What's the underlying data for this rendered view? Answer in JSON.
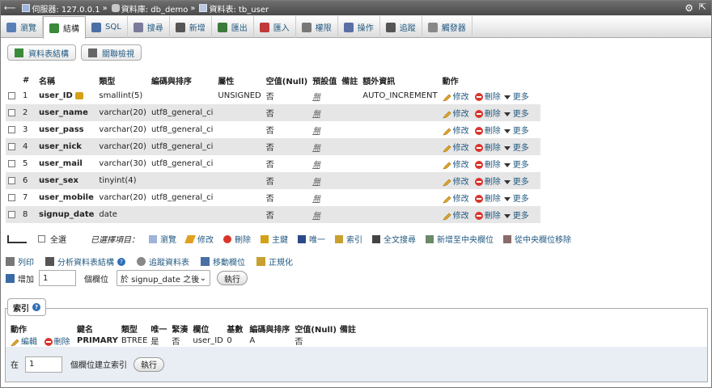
{
  "breadcrumb": {
    "collapse_icon": "arrow-left",
    "server": "伺服器: 127.0.0.1",
    "sep1": "»",
    "database": "資料庫: db_demo",
    "sep2": "»",
    "table": "資料表: tb_user"
  },
  "tabs": [
    {
      "label": "瀏覽",
      "icon": "table-icon",
      "color": "#5a7fb5"
    },
    {
      "label": "結構",
      "icon": "structure-icon",
      "color": "#3a8a3a"
    },
    {
      "label": "SQL",
      "icon": "sql-icon",
      "color": "#4a6fa5"
    },
    {
      "label": "搜尋",
      "icon": "search-icon",
      "color": "#7a7a9a"
    },
    {
      "label": "新增",
      "icon": "insert-icon",
      "color": "#555"
    },
    {
      "label": "匯出",
      "icon": "export-icon",
      "color": "#3a7a3a"
    },
    {
      "label": "匯入",
      "icon": "import-icon",
      "color": "#c03a3a"
    },
    {
      "label": "權限",
      "icon": "privileges-icon",
      "color": "#777"
    },
    {
      "label": "操作",
      "icon": "wrench-icon",
      "color": "#5a6fa5"
    },
    {
      "label": "追蹤",
      "icon": "eye-icon",
      "color": "#555"
    },
    {
      "label": "觸發器",
      "icon": "triggers-icon",
      "color": "#888"
    }
  ],
  "subtabs": {
    "structure": "資料表結構",
    "relation": "關聯檢視"
  },
  "headers": {
    "num": "#",
    "name": "名稱",
    "type": "類型",
    "collation": "編碼與排序",
    "attributes": "屬性",
    "null": "空值(Null)",
    "default": "預設值",
    "comments": "備註",
    "extra": "額外資訊",
    "action": "動作"
  },
  "columns": [
    {
      "num": "1",
      "name": "user_ID",
      "key": true,
      "type": "smallint(5)",
      "collation": "",
      "attributes": "UNSIGNED",
      "null": "否",
      "default": "無",
      "extra": "AUTO_INCREMENT"
    },
    {
      "num": "2",
      "name": "user_name",
      "key": false,
      "type": "varchar(20)",
      "collation": "utf8_general_ci",
      "attributes": "",
      "null": "否",
      "default": "無",
      "extra": ""
    },
    {
      "num": "3",
      "name": "user_pass",
      "key": false,
      "type": "varchar(20)",
      "collation": "utf8_general_ci",
      "attributes": "",
      "null": "否",
      "default": "無",
      "extra": ""
    },
    {
      "num": "4",
      "name": "user_nick",
      "key": false,
      "type": "varchar(20)",
      "collation": "utf8_general_ci",
      "attributes": "",
      "null": "否",
      "default": "無",
      "extra": ""
    },
    {
      "num": "5",
      "name": "user_mail",
      "key": false,
      "type": "varchar(30)",
      "collation": "utf8_general_ci",
      "attributes": "",
      "null": "否",
      "default": "無",
      "extra": ""
    },
    {
      "num": "6",
      "name": "user_sex",
      "key": false,
      "type": "tinyint(4)",
      "collation": "",
      "attributes": "",
      "null": "否",
      "default": "無",
      "extra": ""
    },
    {
      "num": "7",
      "name": "user_mobile",
      "key": false,
      "type": "varchar(20)",
      "collation": "utf8_general_ci",
      "attributes": "",
      "null": "否",
      "default": "無",
      "extra": ""
    },
    {
      "num": "8",
      "name": "signup_date",
      "key": false,
      "type": "date",
      "collation": "",
      "attributes": "",
      "null": "否",
      "default": "無",
      "extra": ""
    }
  ],
  "row_actions": {
    "change": "修改",
    "drop": "刪除",
    "more": "更多"
  },
  "bulk": {
    "check_all": "全選",
    "with_selected": "已選擇項目：",
    "browse": "瀏覽",
    "change": "修改",
    "drop": "刪除",
    "primary": "主鍵",
    "unique": "唯一",
    "index": "索引",
    "fulltext": "全文搜尋",
    "add_central": "新增至中央欄位",
    "remove_central": "從中央欄位移除"
  },
  "tools": {
    "print": "列印",
    "propose": "分析資料表結構",
    "track": "追蹤資料表",
    "move": "移動欄位",
    "normalize": "正規化"
  },
  "add": {
    "label": "增加",
    "count": "1",
    "suffix": "個欄位",
    "position": "於 signup_date 之後",
    "go": "執行"
  },
  "indexes": {
    "legend": "索引",
    "headers": {
      "action": "動作",
      "keyname": "鍵名",
      "type": "類型",
      "unique": "唯一",
      "packed": "緊湊",
      "column": "欄位",
      "cardinality": "基數",
      "collation": "編碼與排序",
      "null": "空值(Null)",
      "comment": "備註"
    },
    "rows": [
      {
        "edit": "編輯",
        "drop": "刪除",
        "keyname": "PRIMARY",
        "type": "BTREE",
        "unique": "是",
        "packed": "否",
        "column": "user_ID",
        "cardinality": "0",
        "collation": "A",
        "null": "否",
        "comment": ""
      }
    ]
  },
  "create_index": {
    "prefix": "在",
    "count": "1",
    "suffix": "個欄位建立索引",
    "go": "執行"
  }
}
